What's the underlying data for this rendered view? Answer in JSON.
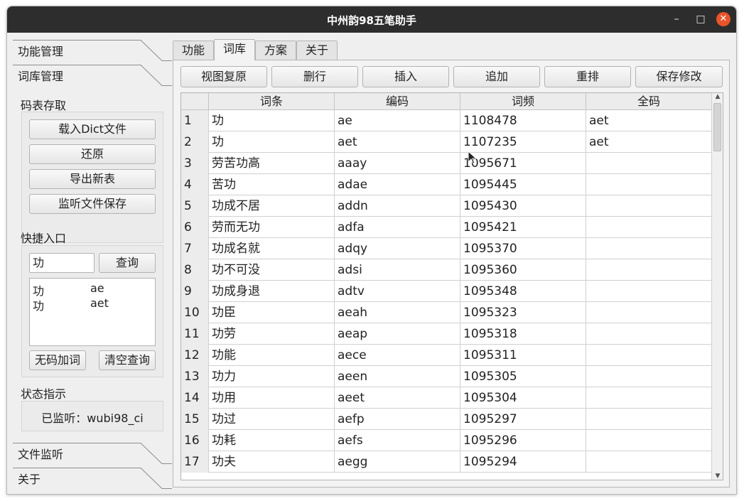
{
  "window": {
    "title": "中州韵98五笔助手",
    "minimize_glyph": "–",
    "maximize_glyph": "□",
    "close_glyph": "✕"
  },
  "toolbox": {
    "sections": [
      "功能管理",
      "词库管理",
      "文件监听",
      "关于"
    ]
  },
  "codetable": {
    "title": "码表存取",
    "buttons": [
      "载入Dict文件",
      "还原",
      "导出新表",
      "监听文件保存"
    ]
  },
  "quick": {
    "title": "快捷入口",
    "input_value": "功",
    "query_button": "查询",
    "results": [
      {
        "word": "功",
        "code": "ae"
      },
      {
        "word": "功",
        "code": "aet"
      }
    ],
    "add_button": "无码加词",
    "clear_button": "清空查询"
  },
  "status": {
    "title": "状态指示",
    "text": "已监听：wubi98_ci"
  },
  "tabs": [
    "功能",
    "词库",
    "方案",
    "关于"
  ],
  "active_tab": 1,
  "actions": [
    "视图复原",
    "删行",
    "插入",
    "追加",
    "重排",
    "保存修改"
  ],
  "table": {
    "headers": [
      "词条",
      "编码",
      "词频",
      "全码"
    ],
    "rows": [
      {
        "n": "1",
        "word": "功",
        "code": "ae",
        "freq": "1108478",
        "full": "aet"
      },
      {
        "n": "2",
        "word": "功",
        "code": "aet",
        "freq": "1107235",
        "full": "aet"
      },
      {
        "n": "3",
        "word": "劳苦功高",
        "code": "aaay",
        "freq": "1095671",
        "full": ""
      },
      {
        "n": "4",
        "word": "苦功",
        "code": "adae",
        "freq": "1095445",
        "full": ""
      },
      {
        "n": "5",
        "word": "功成不居",
        "code": "addn",
        "freq": "1095430",
        "full": ""
      },
      {
        "n": "6",
        "word": "劳而无功",
        "code": "adfa",
        "freq": "1095421",
        "full": ""
      },
      {
        "n": "7",
        "word": "功成名就",
        "code": "adqy",
        "freq": "1095370",
        "full": ""
      },
      {
        "n": "8",
        "word": "功不可没",
        "code": "adsi",
        "freq": "1095360",
        "full": ""
      },
      {
        "n": "9",
        "word": "功成身退",
        "code": "adtv",
        "freq": "1095348",
        "full": ""
      },
      {
        "n": "10",
        "word": "功臣",
        "code": "aeah",
        "freq": "1095323",
        "full": ""
      },
      {
        "n": "11",
        "word": "功劳",
        "code": "aeap",
        "freq": "1095318",
        "full": ""
      },
      {
        "n": "12",
        "word": "功能",
        "code": "aece",
        "freq": "1095311",
        "full": ""
      },
      {
        "n": "13",
        "word": "功力",
        "code": "aeen",
        "freq": "1095305",
        "full": ""
      },
      {
        "n": "14",
        "word": "功用",
        "code": "aeet",
        "freq": "1095304",
        "full": ""
      },
      {
        "n": "15",
        "word": "功过",
        "code": "aefp",
        "freq": "1095297",
        "full": ""
      },
      {
        "n": "16",
        "word": "功耗",
        "code": "aefs",
        "freq": "1095296",
        "full": ""
      },
      {
        "n": "17",
        "word": "功夫",
        "code": "aegg",
        "freq": "1095294",
        "full": ""
      }
    ]
  }
}
